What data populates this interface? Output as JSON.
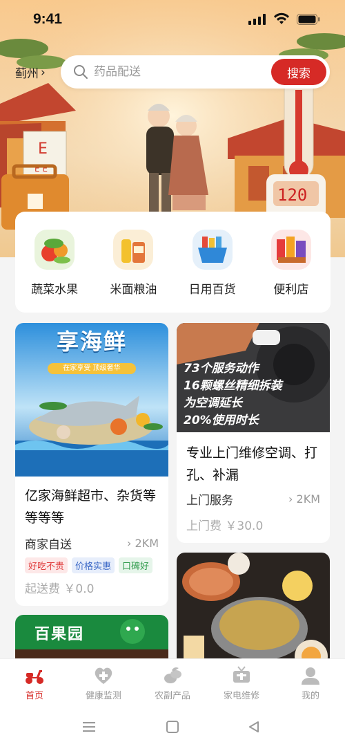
{
  "status": {
    "time": "9:41"
  },
  "location": {
    "city": "蓟州",
    "chevron": "›"
  },
  "search": {
    "placeholder": "药品配送",
    "button": "搜索"
  },
  "categories": [
    {
      "label": "蔬菜水果",
      "icon": "vegetables-icon"
    },
    {
      "label": "米面粮油",
      "icon": "grain-oil-icon"
    },
    {
      "label": "日用百货",
      "icon": "daily-goods-icon"
    },
    {
      "label": "便利店",
      "icon": "convenience-store-icon"
    }
  ],
  "cards": {
    "seafood": {
      "banner_title": "享海鲜",
      "banner_sub": "在家享受 顶级奢华",
      "title": "亿家海鲜超市、杂货等等等等",
      "type": "商家自送",
      "distance": "2KM",
      "tags": [
        "好吃不贵",
        "价格实惠",
        "口碑好"
      ],
      "fee": "起送费 ￥0.0"
    },
    "repair": {
      "lines": [
        "73个服务动作",
        "16颗螺丝精细拆装",
        "为空调延长",
        "20%使用时长"
      ],
      "title": "专业上门维修空调、打孔、补漏",
      "type": "上门服务",
      "distance": "2KM",
      "fee": "上门费 ￥30.0"
    },
    "fruit": {
      "sign": "百果园"
    }
  },
  "tabs": [
    {
      "label": "首页",
      "icon": "scooter-icon",
      "active": true
    },
    {
      "label": "健康监测",
      "icon": "heart-plus-icon",
      "active": false
    },
    {
      "label": "农副产品",
      "icon": "produce-icon",
      "active": false
    },
    {
      "label": "家电维修",
      "icon": "tv-repair-icon",
      "active": false
    },
    {
      "label": "我的",
      "icon": "user-icon",
      "active": false
    }
  ],
  "colors": {
    "accent": "#d62a26",
    "tab_inactive": "#bbbbbb"
  }
}
